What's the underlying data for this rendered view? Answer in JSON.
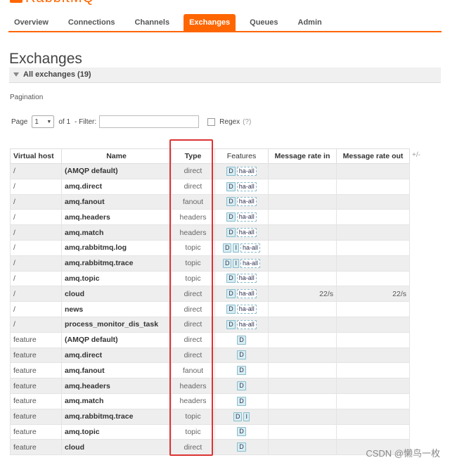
{
  "logo": {
    "text": "RabbitMQ"
  },
  "tabs": [
    {
      "label": "Overview",
      "active": false
    },
    {
      "label": "Connections",
      "active": false
    },
    {
      "label": "Channels",
      "active": false
    },
    {
      "label": "Exchanges",
      "active": true
    },
    {
      "label": "Queues",
      "active": false
    },
    {
      "label": "Admin",
      "active": false
    }
  ],
  "page_title": "Exchanges",
  "section": {
    "label": "All exchanges (19)"
  },
  "pagination": {
    "label": "Pagination",
    "page_label": "Page",
    "page_value": "1",
    "of_label": "of 1",
    "filter_label": "- Filter:",
    "filter_value": "",
    "regex_label": "Regex",
    "regex_help": "(?)"
  },
  "table": {
    "headers": {
      "vhost": "Virtual host",
      "name": "Name",
      "type": "Type",
      "features": "Features",
      "rate_in": "Message rate in",
      "rate_out": "Message rate out",
      "plusminus": "+/-"
    },
    "rows": [
      {
        "vhost": "/",
        "name": "(AMQP default)",
        "type": "direct",
        "features": [
          "D"
        ],
        "policy": "ha-all",
        "rate_in": "",
        "rate_out": ""
      },
      {
        "vhost": "/",
        "name": "amq.direct",
        "type": "direct",
        "features": [
          "D"
        ],
        "policy": "ha-all",
        "rate_in": "",
        "rate_out": ""
      },
      {
        "vhost": "/",
        "name": "amq.fanout",
        "type": "fanout",
        "features": [
          "D"
        ],
        "policy": "ha-all",
        "rate_in": "",
        "rate_out": ""
      },
      {
        "vhost": "/",
        "name": "amq.headers",
        "type": "headers",
        "features": [
          "D"
        ],
        "policy": "ha-all",
        "rate_in": "",
        "rate_out": ""
      },
      {
        "vhost": "/",
        "name": "amq.match",
        "type": "headers",
        "features": [
          "D"
        ],
        "policy": "ha-all",
        "rate_in": "",
        "rate_out": ""
      },
      {
        "vhost": "/",
        "name": "amq.rabbitmq.log",
        "type": "topic",
        "features": [
          "D",
          "I"
        ],
        "policy": "ha-all",
        "rate_in": "",
        "rate_out": ""
      },
      {
        "vhost": "/",
        "name": "amq.rabbitmq.trace",
        "type": "topic",
        "features": [
          "D",
          "I"
        ],
        "policy": "ha-all",
        "rate_in": "",
        "rate_out": ""
      },
      {
        "vhost": "/",
        "name": "amq.topic",
        "type": "topic",
        "features": [
          "D"
        ],
        "policy": "ha-all",
        "rate_in": "",
        "rate_out": ""
      },
      {
        "vhost": "/",
        "name": "cloud",
        "type": "direct",
        "features": [
          "D"
        ],
        "policy": "ha-all",
        "rate_in": "22/s",
        "rate_out": "22/s"
      },
      {
        "vhost": "/",
        "name": "news",
        "type": "direct",
        "features": [
          "D"
        ],
        "policy": "ha-all",
        "rate_in": "",
        "rate_out": ""
      },
      {
        "vhost": "/",
        "name": "process_monitor_dis_task",
        "type": "direct",
        "features": [
          "D"
        ],
        "policy": "ha-all",
        "rate_in": "",
        "rate_out": ""
      },
      {
        "vhost": "feature",
        "name": "(AMQP default)",
        "type": "direct",
        "features": [
          "D"
        ],
        "policy": "",
        "rate_in": "",
        "rate_out": ""
      },
      {
        "vhost": "feature",
        "name": "amq.direct",
        "type": "direct",
        "features": [
          "D"
        ],
        "policy": "",
        "rate_in": "",
        "rate_out": ""
      },
      {
        "vhost": "feature",
        "name": "amq.fanout",
        "type": "fanout",
        "features": [
          "D"
        ],
        "policy": "",
        "rate_in": "",
        "rate_out": ""
      },
      {
        "vhost": "feature",
        "name": "amq.headers",
        "type": "headers",
        "features": [
          "D"
        ],
        "policy": "",
        "rate_in": "",
        "rate_out": ""
      },
      {
        "vhost": "feature",
        "name": "amq.match",
        "type": "headers",
        "features": [
          "D"
        ],
        "policy": "",
        "rate_in": "",
        "rate_out": ""
      },
      {
        "vhost": "feature",
        "name": "amq.rabbitmq.trace",
        "type": "topic",
        "features": [
          "D",
          "I"
        ],
        "policy": "",
        "rate_in": "",
        "rate_out": ""
      },
      {
        "vhost": "feature",
        "name": "amq.topic",
        "type": "topic",
        "features": [
          "D"
        ],
        "policy": "",
        "rate_in": "",
        "rate_out": ""
      },
      {
        "vhost": "feature",
        "name": "cloud",
        "type": "direct",
        "features": [
          "D"
        ],
        "policy": "",
        "rate_in": "",
        "rate_out": ""
      }
    ]
  },
  "watermark": "CSDN @懒鸟一枚",
  "colors": {
    "accent": "#ff6600",
    "highlight": "#dd3333",
    "row_alt": "#eeeeee",
    "badge_bg": "#d8eef2"
  }
}
